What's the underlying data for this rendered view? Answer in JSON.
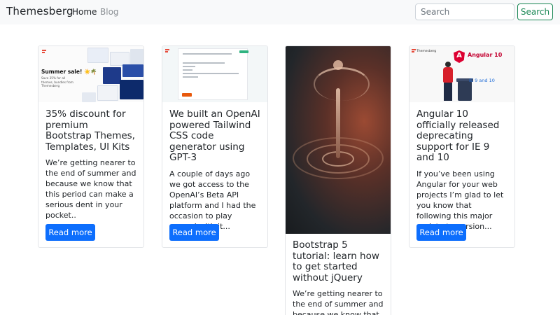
{
  "navbar": {
    "brand": "Themesberg",
    "links": [
      "Home",
      "Blog"
    ],
    "search_placeholder": "Search",
    "search_button": "Search"
  },
  "cards": [
    {
      "title": "35% discount for premium Bootstrap Themes, Templates, UI Kits",
      "text": "We’re getting nearer to the end of summer and because we know that this period can make a serious dent in your pocket..",
      "button": "Read more",
      "image": {
        "headline": "Summer sale! ☀️🌴",
        "caption": "Save 35% for all themes, bundles from Themesberg"
      }
    },
    {
      "title": "We built an OpenAI powered Tailwind CSS code generator using GPT-3",
      "text": "A couple of days ago we got access to the OpenAI’s Beta API platform and I had the occasion to play around with it...",
      "button": "Read more"
    },
    {
      "title": "Bootstrap 5 tutorial: learn how to get started without jQuery",
      "text": "We’re getting nearer to the end of summer and because we know that"
    },
    {
      "title": "Angular 10 officially released deprecating support for IE 9 and 10",
      "text": "If you’ve been using Angular for your web projects I’m glad to let you know that following this major update to version...",
      "button": "Read more",
      "image": {
        "brand": "Themesberg",
        "headline": "Angular 10",
        "ie_label": "IE 9 and 10"
      }
    }
  ],
  "colors": {
    "primary": "#0d6efd",
    "success": "#198754",
    "navbar_bg": "#f8f9fa",
    "angular_red": "#dd0031"
  }
}
